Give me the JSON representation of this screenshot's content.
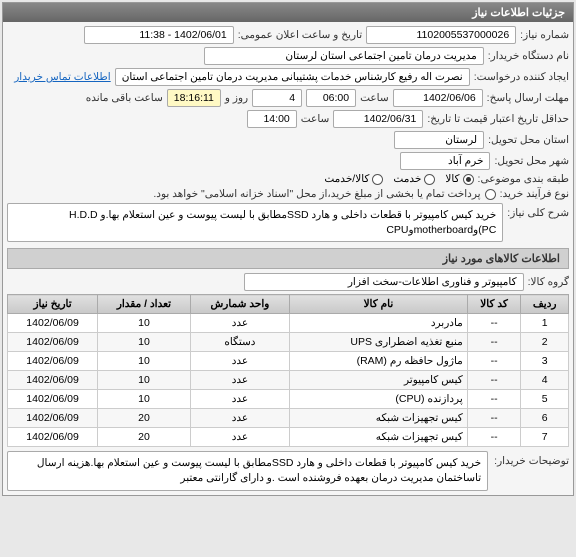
{
  "panel_title": "جزئیات اطلاعات نیاز",
  "fields": {
    "need_no_label": "شماره نیاز:",
    "need_no": "1102005537000026",
    "announce_label": "تاریخ و ساعت اعلان عمومی:",
    "announce": "1402/06/01 - 11:38",
    "buyer_label": "نام دستگاه خریدار:",
    "buyer": "مدیریت درمان تامین اجتماعی استان لرستان",
    "creator_label": "ایجاد کننده درخواست:",
    "creator": "نصرت اله رفیع کارشناس خدمات پشتیبانی مدیریت درمان تامین اجتماعی استان",
    "contact_link": "اطلاعات تماس خریدار",
    "deadline_label": "مهلت ارسال پاسخ:",
    "deadline_date": "1402/06/06",
    "deadline_time_label": "ساعت",
    "deadline_time": "06:00",
    "remain_days": "4",
    "remain_days_label": "روز و",
    "remain_time": "18:16:11",
    "remain_time_label": "ساعت باقی مانده",
    "valid_label": "حداقل تاریخ اعتبار قیمت تا تاریخ:",
    "valid_date": "1402/06/31",
    "valid_time_label": "ساعت",
    "valid_time": "14:00",
    "province_label": "استان محل تحویل:",
    "province": "لرستان",
    "city_label": "شهر محل تحویل:",
    "city": "خرم آباد",
    "category_label": "طبقه بندی موضوعی:",
    "cat_goods": "کالا",
    "cat_service": "خدمت",
    "cat_goods_service": "کالا/خدمت",
    "process_label": "نوع فرآیند خرید:",
    "process_note": "پرداخت تمام یا بخشی از مبلغ خرید،از محل \"اسناد خزانه اسلامی\" خواهد بود.",
    "desc_label": "شرح کلی نیاز:",
    "desc": "خرید کیس کامپیوتر با قطعات داخلی و هارد SSDمطابق با لیست پیوست و عین استعلام بها.و H.D.D (PCوmotherboardوCPU"
  },
  "items_title": "اطلاعات کالاهای مورد نیاز",
  "group_label": "گروه کالا:",
  "group_value": "کامپیوتر و فناوری اطلاعات-سخت افزار",
  "table": {
    "headers": [
      "ردیف",
      "کد کالا",
      "نام کالا",
      "واحد شمارش",
      "تعداد / مقدار",
      "تاریخ نیاز"
    ],
    "rows": [
      [
        "1",
        "--",
        "مادربرد",
        "عدد",
        "10",
        "1402/06/09"
      ],
      [
        "2",
        "--",
        "منبع تغذیه اضطراری UPS",
        "دستگاه",
        "10",
        "1402/06/09"
      ],
      [
        "3",
        "--",
        "ماژول حافظه رم (RAM)",
        "عدد",
        "10",
        "1402/06/09"
      ],
      [
        "4",
        "--",
        "کیس کامپیوتر",
        "عدد",
        "10",
        "1402/06/09"
      ],
      [
        "5",
        "--",
        "پردازنده (CPU)",
        "عدد",
        "10",
        "1402/06/09"
      ],
      [
        "6",
        "--",
        "کیس تجهیزات شبکه",
        "عدد",
        "20",
        "1402/06/09"
      ],
      [
        "7",
        "--",
        "کیس تجهیزات شبکه",
        "عدد",
        "20",
        "1402/06/09"
      ]
    ]
  },
  "notes_label": "توضیحات خریدار:",
  "notes": "خرید کیس کامپیوتر با قطعات داخلی و هارد SSDمطابق با لیست پیوست و عین استعلام بها.هزینه ارسال تاساختمان مدیریت درمان بعهده فروشنده است .و دارای گارانتی معتبر"
}
